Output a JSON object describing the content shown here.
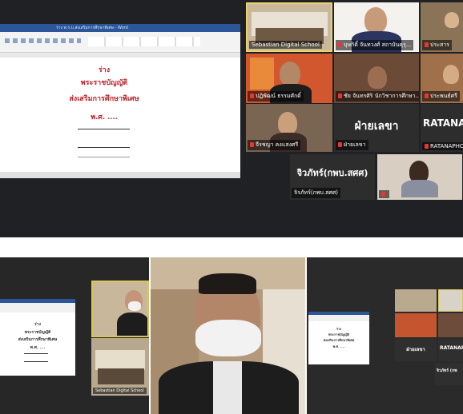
{
  "top": {
    "document": {
      "title_bar": "ร่าง พ.ร.บ.ส่งเสริมการศึกษาพิเศษ - Word",
      "lines": [
        "ร่าง",
        "พระราชบัญญัติ",
        "ส่งเสริมการศึกษาพิเศษ",
        "พ.ศ. ...."
      ]
    },
    "participants": [
      {
        "name": "Sebastian Digital School",
        "muted": false
      },
      {
        "name": "บุษกิติ์ จันทวงศ์ สถาบันคุรุ...",
        "muted": true
      },
      {
        "name": "ประสาร",
        "muted": true
      },
      {
        "name": "ปฏิพัฒน์ ธรรมศักดิ์",
        "muted": true
      },
      {
        "name": "ชัย จันทรศิริ นักวิชาการศึกษา...",
        "muted": true
      },
      {
        "name": "ประพนธ์ศรี",
        "muted": true
      },
      {
        "name": "จีรชญา คงแสงศรี",
        "muted": true
      },
      {
        "name": "ฝ่ายเลขา",
        "label": "ฝ่ายเลขา",
        "muted": true
      },
      {
        "name": "RATANAPHON",
        "label": "RATANA",
        "muted": true
      },
      {
        "name": "จิรภัทร์(กพบ.สศศ)",
        "label": "จิวภัทร์(กพบ.สศศ)",
        "muted": false
      },
      {
        "name": "",
        "muted": true
      }
    ]
  },
  "bottom": {
    "left": {
      "doc_lines": [
        "ร่าง",
        "พระราชบัญญัติ",
        "ส่งเสริมการศึกษาพิเศษ",
        "พ.ศ. ...."
      ],
      "tile_name": "Sebastian Digital School"
    },
    "center": {},
    "right": {
      "doc_lines": [
        "ร่าง",
        "พระราชบัญญัติ",
        "ส่งเสริมการศึกษาพิเศษ",
        "พ.ศ. ...."
      ],
      "labels": [
        "ฝ่ายเลขา",
        "RATANAP",
        "จิวภัทร์ (กพ"
      ]
    }
  }
}
